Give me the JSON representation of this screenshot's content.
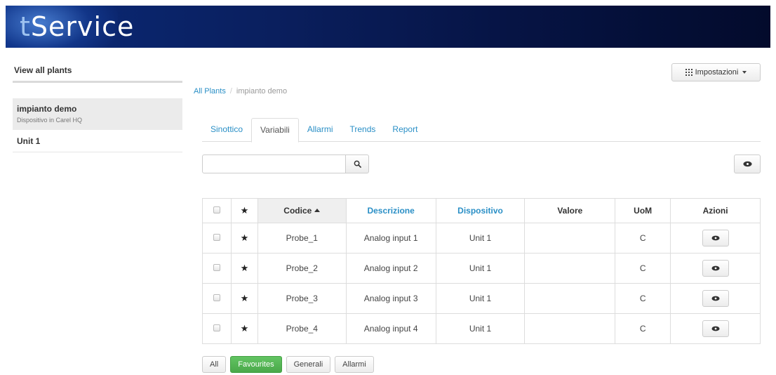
{
  "header": {
    "logo_prefix": "t",
    "logo_main": "Service"
  },
  "sidebar": {
    "title": "View all plants",
    "plant": {
      "name": "impianto demo",
      "subtitle": "Dispositivo in Carel HQ"
    },
    "unit_label": "Unit 1"
  },
  "toolbar": {
    "settings_label": "Impostazioni"
  },
  "breadcrumb": {
    "root": "All Plants",
    "separator": "/",
    "current": "impianto demo"
  },
  "tabs": [
    {
      "label": "Sinottico",
      "active": false
    },
    {
      "label": "Variabili",
      "active": true
    },
    {
      "label": "Allarmi",
      "active": false
    },
    {
      "label": "Trends",
      "active": false
    },
    {
      "label": "Report",
      "active": false
    }
  ],
  "search": {
    "value": ""
  },
  "table": {
    "columns": {
      "codice": "Codice",
      "descrizione": "Descrizione",
      "dispositivo": "Dispositivo",
      "valore": "Valore",
      "uom": "UoM",
      "azioni": "Azioni"
    },
    "star_glyph": "★",
    "rows": [
      {
        "codice": "Probe_1",
        "descrizione": "Analog input 1",
        "dispositivo": "Unit 1",
        "valore": "",
        "uom": "C"
      },
      {
        "codice": "Probe_2",
        "descrizione": "Analog input 2",
        "dispositivo": "Unit 1",
        "valore": "",
        "uom": "C"
      },
      {
        "codice": "Probe_3",
        "descrizione": "Analog input 3",
        "dispositivo": "Unit 1",
        "valore": "",
        "uom": "C"
      },
      {
        "codice": "Probe_4",
        "descrizione": "Analog input 4",
        "dispositivo": "Unit 1",
        "valore": "",
        "uom": "C"
      }
    ]
  },
  "filters": [
    {
      "label": "All",
      "active": false
    },
    {
      "label": "Favourites",
      "active": true
    },
    {
      "label": "Generali",
      "active": false
    },
    {
      "label": "Allarmi",
      "active": false
    }
  ],
  "colors": {
    "link": "#2a8fc6",
    "active_filter": "#5cb85c",
    "banner": "#0a1f5e"
  }
}
